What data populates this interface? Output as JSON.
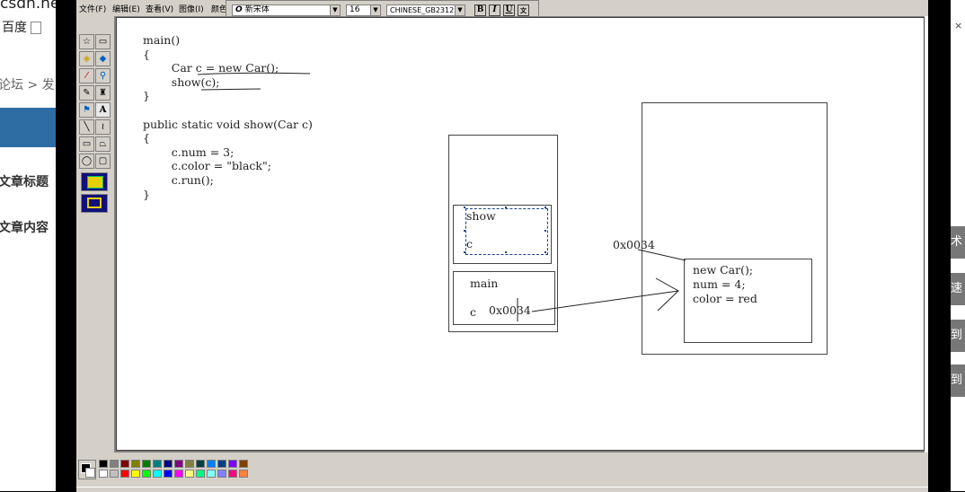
{
  "background": {
    "url": "csdn.net",
    "bookmark": "百度",
    "breadcrumb": "论坛 > 发",
    "article_title_label": "文章标题",
    "article_content_label": "文章内容",
    "right_buttons": [
      "术",
      "速",
      "到",
      "到"
    ]
  },
  "paint": {
    "menu": [
      "文件(F)",
      "编辑(E)",
      "查看(V)",
      "图像(I)",
      "颜色"
    ],
    "font_name": "新宋体",
    "font_size": "16",
    "charset": "CHINESE_GB2312",
    "style_buttons": [
      "B",
      "I",
      "U",
      "文"
    ],
    "accent": "#10107a"
  },
  "code": {
    "lines": [
      "main()",
      "{",
      "        Car c = new Car();",
      "        show(c);",
      "}",
      "",
      "public static void show(Car c)",
      "{",
      "        c.num = 3;",
      "        c.color = \"black\";",
      "        c.run();",
      "}"
    ]
  },
  "diagram": {
    "show_frame": "show",
    "show_var": "c",
    "main_frame": "main",
    "main_var": "c",
    "main_addr": "0x0034",
    "heap_addr": "0x0034",
    "heap_lines": [
      "new Car();",
      "num = 4;",
      "color = red"
    ]
  },
  "palette_colors": [
    "#000000",
    "#808080",
    "#800000",
    "#808000",
    "#008000",
    "#008080",
    "#000080",
    "#800080",
    "#808040",
    "#004040",
    "#0080ff",
    "#004080",
    "#8000ff",
    "#804000",
    "#ffffff",
    "#c0c0c0",
    "#ff0000",
    "#ffff00",
    "#00ff00",
    "#00ffff",
    "#0000ff",
    "#ff00ff",
    "#ffff80",
    "#00ff80",
    "#80ffff",
    "#8080ff",
    "#ff0080",
    "#ff8040"
  ]
}
